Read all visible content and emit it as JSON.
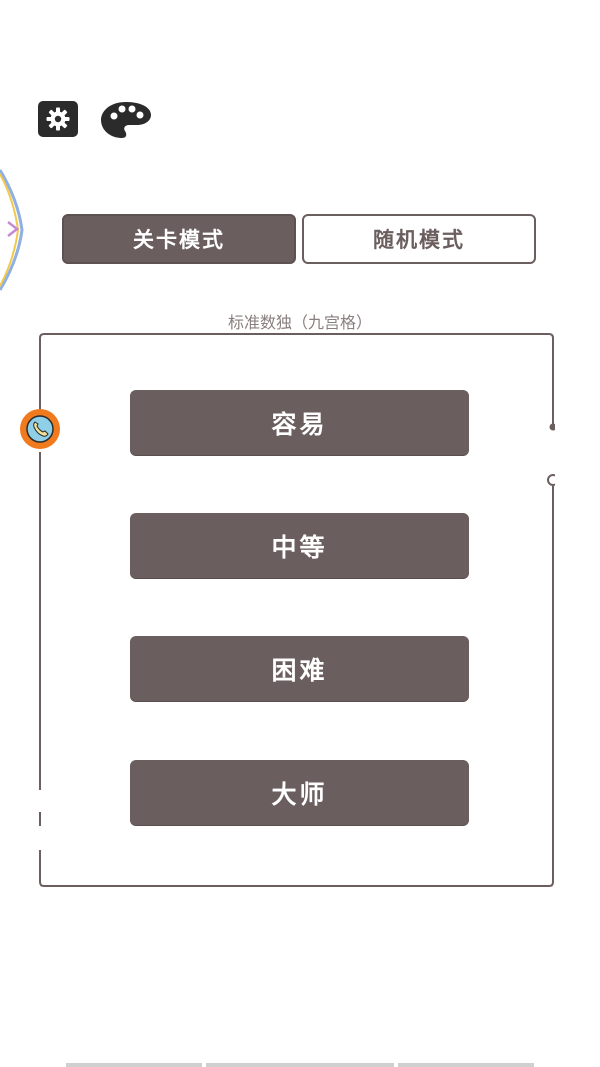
{
  "top_icons": [
    "gear-icon",
    "palette-icon"
  ],
  "tabs": [
    {
      "label": "关卡模式",
      "selected": true
    },
    {
      "label": "随机模式",
      "selected": false
    }
  ],
  "subtitle": "标准数独（九宫格）",
  "difficulties": [
    {
      "label": "容易"
    },
    {
      "label": "中等"
    },
    {
      "label": "困难"
    },
    {
      "label": "大师"
    }
  ],
  "colors": {
    "primary": "#6b5e5e",
    "background": "#ffffff",
    "float_ball": "#f07a1e"
  }
}
